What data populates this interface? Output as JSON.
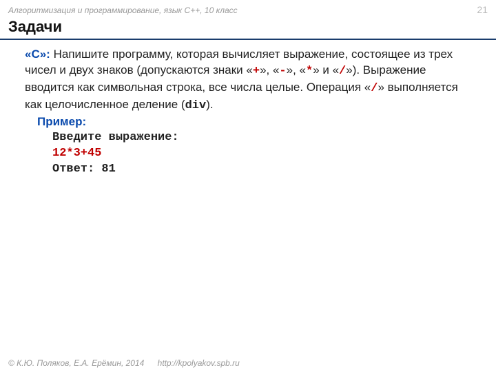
{
  "header": {
    "course": "Алгоритмизация и программирование, язык C++, 10 класс",
    "page_number": "21"
  },
  "title": "Задачи",
  "task": {
    "label": "«C»:",
    "text_1": " Напишите программу, которая вычисляет выражение, состоящее из трех чисел и двух знаков (допускаются знаки «",
    "op_plus": "+",
    "text_2": "», «",
    "op_minus": "-",
    "text_3": "», «",
    "op_mul": "*",
    "text_4": "» и «",
    "op_div_sym": "/",
    "text_5": "»). Выражение вводится как символьная строка, все числа целые. Операция «",
    "op_div_sym2": "/",
    "text_6": "» выполняется как целочисленное деление (",
    "div_word": "div",
    "text_7": ")."
  },
  "example": {
    "label": "Пример:",
    "line1": "Введите выражение:",
    "line2": "12*3+45",
    "line3": "Ответ: 81"
  },
  "footer": {
    "copyright": "© К.Ю. Поляков, Е.А. Ерёмин, 2014",
    "url": "http://kpolyakov.spb.ru"
  }
}
